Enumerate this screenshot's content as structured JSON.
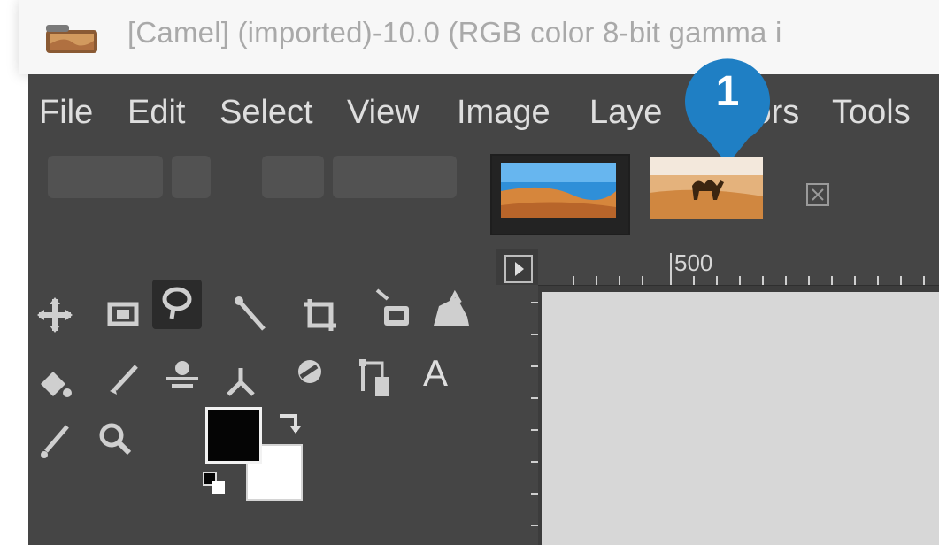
{
  "window": {
    "title": "[Camel] (imported)-10.0 (RGB color 8-bit gamma i"
  },
  "menu": {
    "items": [
      "File",
      "Edit",
      "Select",
      "View",
      "Image",
      "Layer",
      "Colors",
      "Tools"
    ],
    "visible_labels": [
      "File",
      "Edit",
      "Select",
      "View",
      "Image",
      "Laye",
      "lors",
      "Tools"
    ]
  },
  "callout": {
    "number": "1",
    "color": "#1f7fc4"
  },
  "toolbox": {
    "tools_row1": [
      "move-tool-icon",
      "rectangle-select-icon",
      "free-select-icon",
      "fuzzy-select-icon",
      "crop-icon",
      "unified-transform-icon",
      "warp-transform-icon"
    ],
    "tools_row2": [
      "bucket-fill-icon",
      "paintbrush-icon",
      "clone-icon",
      "smudge-icon",
      "dodge-burn-icon",
      "paths-icon",
      "text-tool-icon"
    ],
    "tools_row3": [
      "color-picker-icon",
      "zoom-tool-icon"
    ],
    "active_tool": "free-select-icon",
    "text_tool_glyph": "A",
    "foreground_color": "#050505",
    "background_color": "#ffffff"
  },
  "image_tabs": [
    {
      "name": "desert-landscape-thumbnail",
      "active": true
    },
    {
      "name": "camel-thumbnail",
      "active": false
    }
  ],
  "ruler": {
    "label": "500"
  },
  "colors": {
    "menu_bg": "#454545",
    "canvas": "#d7d7d7",
    "accent": "#1f7fc4"
  }
}
